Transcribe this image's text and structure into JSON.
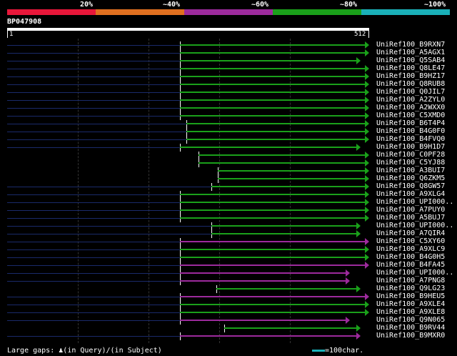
{
  "scale": {
    "labels": [
      "20%",
      "~40%",
      "~60%",
      "~80%",
      "~100%"
    ],
    "colors": [
      "#e8173a",
      "#e07020",
      "#9c2a9c",
      "#1aa01a",
      "#1ab0b8"
    ]
  },
  "query": {
    "id": "BP047908",
    "start": "1",
    "end": "512"
  },
  "hits": [
    {
      "label": "UniRef100_B9RXN7",
      "color": "green",
      "start": 244,
      "end": 512,
      "gap": true
    },
    {
      "label": "UniRef100_A5AGX1",
      "color": "green",
      "start": 244,
      "end": 512,
      "gap": true
    },
    {
      "label": "UniRef100_Q5SAB4",
      "color": "green",
      "start": 244,
      "end": 500,
      "gap": true
    },
    {
      "label": "UniRef100_Q8LE47",
      "color": "green",
      "start": 244,
      "end": 512,
      "gap": true
    },
    {
      "label": "UniRef100_B9HZ17",
      "color": "green",
      "start": 244,
      "end": 512,
      "gap": true
    },
    {
      "label": "UniRef100_Q8RUB8",
      "color": "green",
      "start": 244,
      "end": 512,
      "gap": true
    },
    {
      "label": "UniRef100_Q0JIL7",
      "color": "green",
      "start": 244,
      "end": 512,
      "gap": true
    },
    {
      "label": "UniRef100_A2ZYL0",
      "color": "green",
      "start": 244,
      "end": 512,
      "gap": true
    },
    {
      "label": "UniRef100_A2WXX0",
      "color": "green",
      "start": 244,
      "end": 512,
      "gap": true
    },
    {
      "label": "UniRef100_C5XMD0",
      "color": "green",
      "start": 244,
      "end": 512,
      "gap": true
    },
    {
      "label": "UniRef100_B6T4P4",
      "color": "green",
      "start": 253,
      "end": 512,
      "gap": true
    },
    {
      "label": "UniRef100_B4G0F0",
      "color": "green",
      "start": 253,
      "end": 512,
      "gap": true
    },
    {
      "label": "UniRef100_B4FVQ0",
      "color": "green",
      "start": 253,
      "end": 512,
      "gap": true
    },
    {
      "label": "UniRef100_B9H1D7",
      "color": "green",
      "start": 244,
      "end": 500,
      "gap": true
    },
    {
      "label": "UniRef100_C0PF28",
      "color": "green",
      "start": 271,
      "end": 512,
      "gap": false
    },
    {
      "label": "UniRef100_C5YJ88",
      "color": "green",
      "start": 271,
      "end": 512,
      "gap": false
    },
    {
      "label": "UniRef100_A3BUI7",
      "color": "green",
      "start": 298,
      "end": 512,
      "gap": false
    },
    {
      "label": "UniRef100_Q6ZKM5",
      "color": "green",
      "start": 298,
      "end": 512,
      "gap": false
    },
    {
      "label": "UniRef100_Q8GW57",
      "color": "green",
      "start": 289,
      "end": 512,
      "gap": true
    },
    {
      "label": "UniRef100_A9XLG4",
      "color": "green",
      "start": 244,
      "end": 512,
      "gap": true
    },
    {
      "label": "UniRef100_UPI000..",
      "color": "green",
      "start": 244,
      "end": 512,
      "gap": true
    },
    {
      "label": "UniRef100_A7PUY0",
      "color": "green",
      "start": 244,
      "end": 512,
      "gap": true
    },
    {
      "label": "UniRef100_A5BUJ7",
      "color": "green",
      "start": 244,
      "end": 512,
      "gap": true
    },
    {
      "label": "UniRef100_UPI000..",
      "color": "green",
      "start": 289,
      "end": 500,
      "gap": true
    },
    {
      "label": "UniRef100_A7QIR4",
      "color": "green",
      "start": 289,
      "end": 500,
      "gap": true
    },
    {
      "label": "UniRef100_C5XY60",
      "color": "purple",
      "start": 244,
      "end": 512,
      "gap": true
    },
    {
      "label": "UniRef100_A9XLC9",
      "color": "green",
      "start": 244,
      "end": 512,
      "gap": true
    },
    {
      "label": "UniRef100_B4G0H5",
      "color": "green",
      "start": 244,
      "end": 512,
      "gap": true
    },
    {
      "label": "UniRef100_B4FA45",
      "color": "purple",
      "start": 244,
      "end": 512,
      "gap": true
    },
    {
      "label": "UniRef100_UPI000..",
      "color": "purple",
      "start": 244,
      "end": 485,
      "gap": true
    },
    {
      "label": "UniRef100_A7PNG8",
      "color": "purple",
      "start": 244,
      "end": 485,
      "gap": true
    },
    {
      "label": "UniRef100_Q9LG23",
      "color": "green",
      "start": 296,
      "end": 500,
      "gap": false
    },
    {
      "label": "UniRef100_B9HEU5",
      "color": "purple",
      "start": 244,
      "end": 512,
      "gap": true
    },
    {
      "label": "UniRef100_A9XLE4",
      "color": "green",
      "start": 244,
      "end": 512,
      "gap": true
    },
    {
      "label": "UniRef100_A9XLE8",
      "color": "green",
      "start": 244,
      "end": 512,
      "gap": true
    },
    {
      "label": "UniRef100_Q9N065",
      "color": "purple",
      "start": 244,
      "end": 485,
      "gap": true
    },
    {
      "label": "UniRef100_B9RV44",
      "color": "green",
      "start": 307,
      "end": 500,
      "gap": false
    },
    {
      "label": "UniRef100_B9MXR0",
      "color": "purple",
      "start": 244,
      "end": 500,
      "gap": true
    }
  ],
  "legend": {
    "large_gaps": "Large gaps:",
    "in_query": "(in Query)/",
    "in_subject": "(in Subject)",
    "scale_key": "=100char."
  },
  "colors": {
    "green": "#1aa01a",
    "purple": "#9c2a9c",
    "gapline": "#1a2a6a",
    "key": "#1ab0b8"
  }
}
